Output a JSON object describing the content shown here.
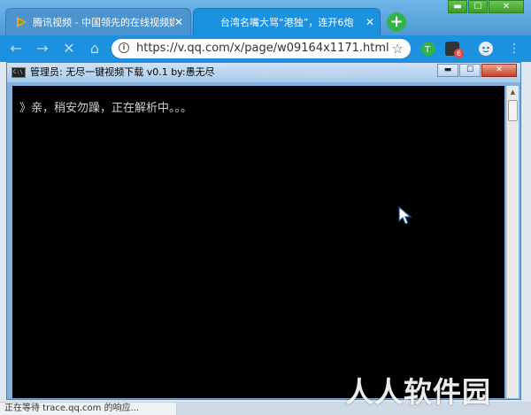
{
  "browser": {
    "tabs": [
      {
        "title": "腾讯视频 - 中国领先的在线视频媒",
        "close": "✕",
        "active": false
      },
      {
        "title": "台湾名嘴大骂“港独”，连开6炮",
        "close": "✕",
        "active": true
      }
    ],
    "new_tab": "+",
    "window_controls": {
      "minimize": "▬",
      "maximize": "☐",
      "close": "✕"
    },
    "nav": {
      "back": "←",
      "forward": "→",
      "reload": "✕",
      "home": "⌂"
    },
    "address": {
      "url": "https://v.qq.com/x/page/w09164x1171.html",
      "info": "i",
      "bookmark": "☆"
    },
    "extension_badge": "6",
    "menu": "⋮"
  },
  "console": {
    "title": "管理员:  无尽一键视频下载 v0.1  by:愚无尽",
    "controls": {
      "minimize": "▬",
      "maximize": "☐",
      "close": "✕"
    },
    "icon_text": "C:\\",
    "output": "》亲，稍安勿躁，正在解析中。。。"
  },
  "status": {
    "text": "正在等待 trace.qq.com 的响应..."
  },
  "watermark": "人人软件园",
  "colors": {
    "accent": "#1c91e0",
    "console_bg": "#000000",
    "console_text": "#d0d0d0"
  }
}
